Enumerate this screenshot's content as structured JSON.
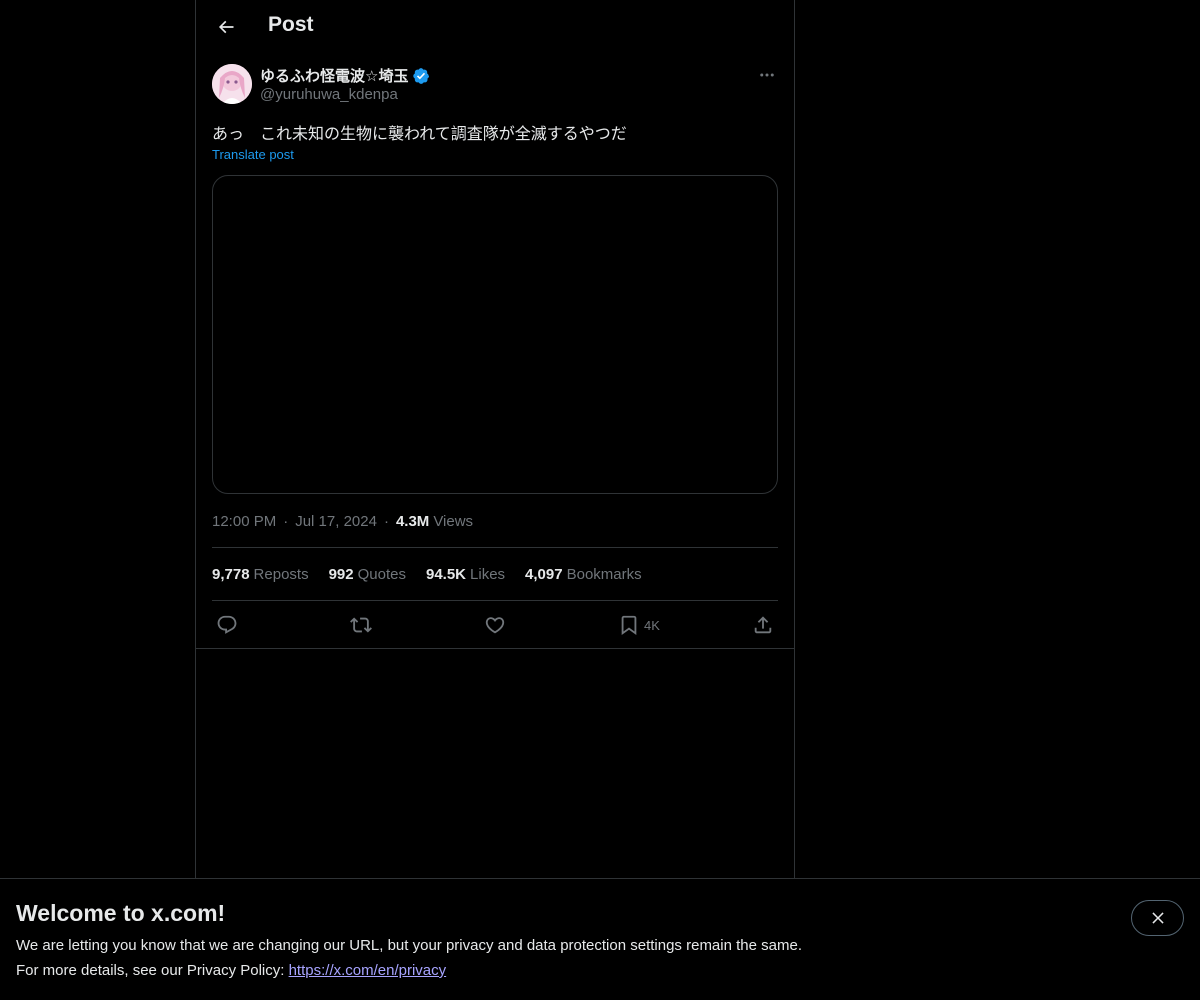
{
  "header": {
    "title": "Post"
  },
  "post": {
    "author_name": "ゆるふわ怪電波☆埼玉",
    "handle": "@yuruhuwa_kdenpa",
    "text": "あっ　これ未知の生物に襲われて調査隊が全滅するやつだ",
    "translate_label": "Translate post",
    "time": "12:00 PM",
    "date": "Jul 17, 2024",
    "views_count": "4.3M",
    "views_label": "Views"
  },
  "stats": {
    "reposts_count": "9,778",
    "reposts_label": "Reposts",
    "quotes_count": "992",
    "quotes_label": "Quotes",
    "likes_count": "94.5K",
    "likes_label": "Likes",
    "bookmarks_count": "4,097",
    "bookmarks_label": "Bookmarks"
  },
  "actions": {
    "bookmark_count": "4K"
  },
  "banner": {
    "title": "Welcome to x.com!",
    "line1": "We are letting you know that we are changing our URL, but your privacy and data protection settings remain the same.",
    "line2_prefix": "For more details, see our Privacy Policy: ",
    "link": "https://x.com/en/privacy"
  },
  "colors": {
    "accent": "#1d9bf0",
    "muted": "#71767b",
    "text": "#e7e9ea",
    "border": "#2f3336",
    "link": "#a7a4ff"
  },
  "icons": [
    "arrow-left-icon",
    "verified-badge-icon",
    "more-icon",
    "reply-icon",
    "repost-icon",
    "like-icon",
    "bookmark-icon",
    "share-icon",
    "close-icon"
  ]
}
